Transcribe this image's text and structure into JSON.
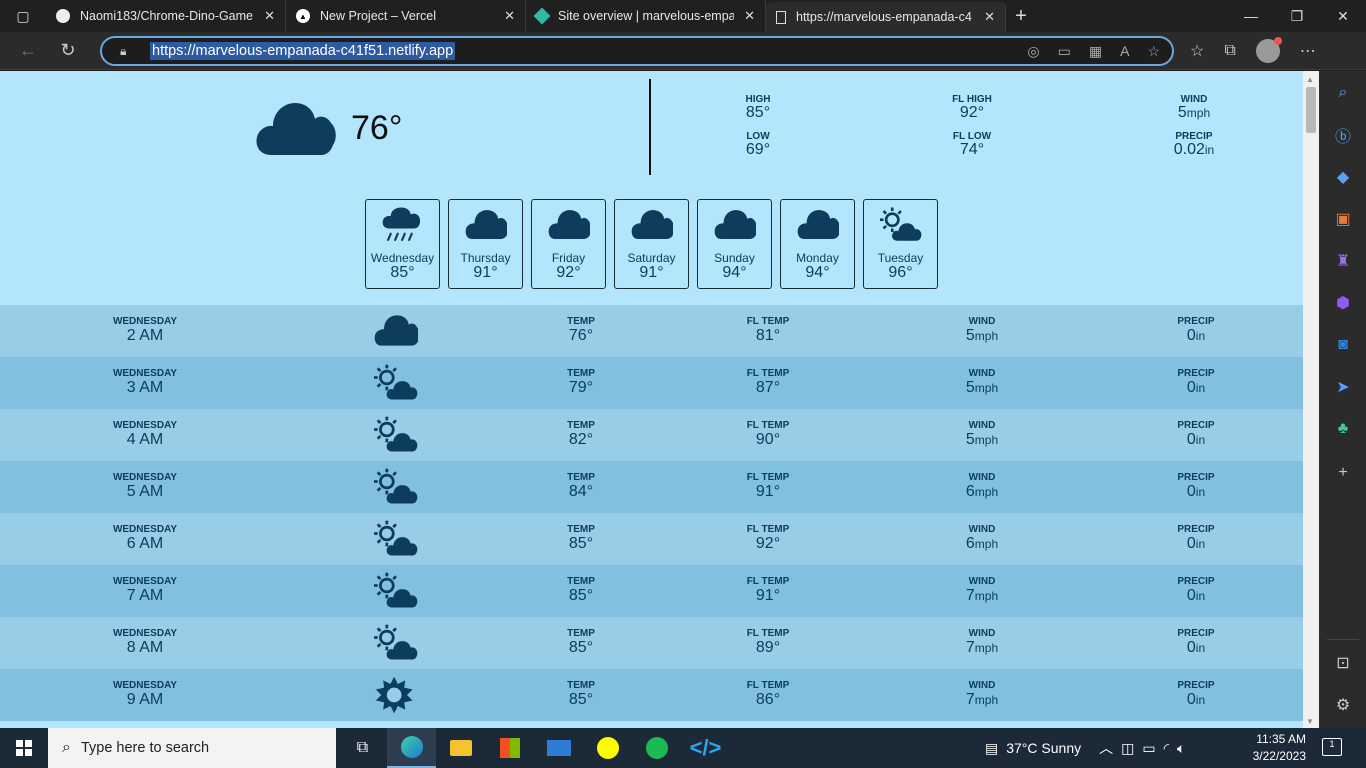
{
  "browser": {
    "tabs": [
      {
        "title": "Naomi183/Chrome-Dino-Game",
        "icon": "github-icon"
      },
      {
        "title": "New Project – Vercel",
        "icon": "vercel-icon"
      },
      {
        "title": "Site overview | marvelous-empan",
        "icon": "netlify-icon"
      },
      {
        "title": "https://marvelous-empanada-c4",
        "icon": "page-icon"
      }
    ],
    "url": "https://marvelous-empanada-c41f51.netlify.app"
  },
  "current": {
    "temp": "76°",
    "icon": "cloud-icon",
    "high_label": "HIGH",
    "high": "85°",
    "low_label": "LOW",
    "low": "69°",
    "fl_high_label": "FL HIGH",
    "fl_high": "92°",
    "fl_low_label": "FL LOW",
    "fl_low": "74°",
    "wind_label": "WIND",
    "wind": "5",
    "wind_unit": "mph",
    "precip_label": "PRECIP",
    "precip": "0.02",
    "precip_unit": "in"
  },
  "days": [
    {
      "name": "Wednesday",
      "temp": "85°",
      "icon": "rain-icon"
    },
    {
      "name": "Thursday",
      "temp": "91°",
      "icon": "cloud-icon"
    },
    {
      "name": "Friday",
      "temp": "92°",
      "icon": "cloud-icon"
    },
    {
      "name": "Saturday",
      "temp": "91°",
      "icon": "cloud-icon"
    },
    {
      "name": "Sunday",
      "temp": "94°",
      "icon": "cloud-icon"
    },
    {
      "name": "Monday",
      "temp": "94°",
      "icon": "cloud-icon"
    },
    {
      "name": "Tuesday",
      "temp": "96°",
      "icon": "partly-cloudy-icon"
    }
  ],
  "hourly_labels": {
    "temp": "TEMP",
    "fl": "FL TEMP",
    "wind": "WIND",
    "precip": "PRECIP",
    "wind_unit": "mph",
    "precip_unit": "in"
  },
  "hours": [
    {
      "day": "WEDNESDAY",
      "time": "2 AM",
      "icon": "cloud-icon",
      "temp": "76°",
      "fl": "81°",
      "wind": "5",
      "precip": "0"
    },
    {
      "day": "WEDNESDAY",
      "time": "3 AM",
      "icon": "partly-cloudy-icon",
      "temp": "79°",
      "fl": "87°",
      "wind": "5",
      "precip": "0"
    },
    {
      "day": "WEDNESDAY",
      "time": "4 AM",
      "icon": "partly-cloudy-icon",
      "temp": "82°",
      "fl": "90°",
      "wind": "5",
      "precip": "0"
    },
    {
      "day": "WEDNESDAY",
      "time": "5 AM",
      "icon": "partly-cloudy-icon",
      "temp": "84°",
      "fl": "91°",
      "wind": "6",
      "precip": "0"
    },
    {
      "day": "WEDNESDAY",
      "time": "6 AM",
      "icon": "partly-cloudy-icon",
      "temp": "85°",
      "fl": "92°",
      "wind": "6",
      "precip": "0"
    },
    {
      "day": "WEDNESDAY",
      "time": "7 AM",
      "icon": "partly-cloudy-icon",
      "temp": "85°",
      "fl": "91°",
      "wind": "7",
      "precip": "0"
    },
    {
      "day": "WEDNESDAY",
      "time": "8 AM",
      "icon": "partly-cloudy-icon",
      "temp": "85°",
      "fl": "89°",
      "wind": "7",
      "precip": "0"
    },
    {
      "day": "WEDNESDAY",
      "time": "9 AM",
      "icon": "sun-icon",
      "temp": "85°",
      "fl": "86°",
      "wind": "7",
      "precip": "0"
    }
  ],
  "taskbar": {
    "search_placeholder": "Type here to search",
    "weather": "37°C  Sunny",
    "time": "11:35 AM",
    "date": "3/22/2023",
    "notifications": "1"
  },
  "colors": {
    "page_bg": "#b3e5fc",
    "row_a": "#99cce6",
    "row_b": "#81c1df",
    "icon": "#0d3c5c"
  }
}
